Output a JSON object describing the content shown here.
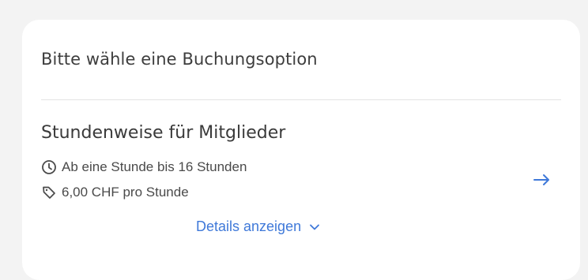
{
  "card": {
    "heading": "Bitte wähle eine Buchungsoption"
  },
  "option": {
    "title": "Stundenweise für Mitglieder",
    "duration": "Ab eine Stunde bis 16 Stunden",
    "price": "6,00 CHF pro Stunde",
    "details_link": "Details anzeigen"
  },
  "icons": {
    "duration": "clock-icon",
    "price": "tag-icon",
    "select": "arrow-right-icon",
    "expand": "chevron-down-icon"
  },
  "colors": {
    "accent": "#3f79d9",
    "text_primary": "#3a3a3a",
    "text_secondary": "#4a4a4a"
  }
}
